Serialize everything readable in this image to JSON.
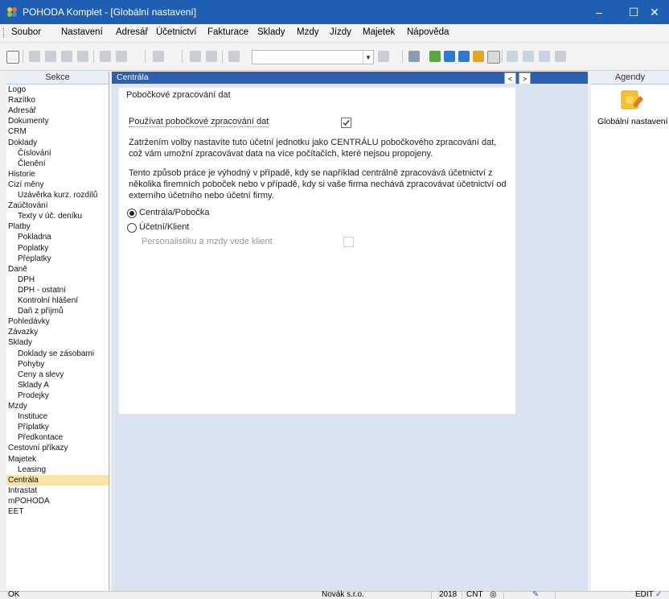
{
  "window": {
    "title": "POHODA Komplet - [Globální nastavení]",
    "minimize_glyph": "–",
    "maximize_glyph": "☐",
    "close_glyph": "✕"
  },
  "menu": [
    "Soubor",
    "Nastavení",
    "Adresář",
    "Účetnictví",
    "Fakturace",
    "Sklady",
    "Mzdy",
    "Jízdy",
    "Majetek",
    "Nápověda"
  ],
  "left_panel": {
    "header": "Sekce",
    "items": [
      {
        "label": "Logo",
        "level": 0
      },
      {
        "label": "Razítko",
        "level": 0
      },
      {
        "label": "Adresář",
        "level": 0
      },
      {
        "label": "Dokumenty",
        "level": 0
      },
      {
        "label": "CRM",
        "level": 0
      },
      {
        "label": "Doklady",
        "level": 0
      },
      {
        "label": "Číslování",
        "level": 1
      },
      {
        "label": "Členění",
        "level": 1
      },
      {
        "label": "Historie",
        "level": 0
      },
      {
        "label": "Cizí měny",
        "level": 0
      },
      {
        "label": "Uzávěrka kurz. rozdílů",
        "level": 1
      },
      {
        "label": "Zaúčtování",
        "level": 0
      },
      {
        "label": "Texty v úč. deníku",
        "level": 1
      },
      {
        "label": "Platby",
        "level": 0
      },
      {
        "label": "Pokladna",
        "level": 1
      },
      {
        "label": "Poplatky",
        "level": 1
      },
      {
        "label": "Přeplatky",
        "level": 1
      },
      {
        "label": "Daně",
        "level": 0
      },
      {
        "label": "DPH",
        "level": 1
      },
      {
        "label": "DPH - ostatní",
        "level": 1
      },
      {
        "label": "Kontrolní hlášení",
        "level": 1
      },
      {
        "label": "Daň z příjmů",
        "level": 1
      },
      {
        "label": "Pohledávky",
        "level": 0
      },
      {
        "label": "Závazky",
        "level": 0
      },
      {
        "label": "Sklady",
        "level": 0
      },
      {
        "label": "Doklady se zásobami",
        "level": 1
      },
      {
        "label": "Pohyby",
        "level": 1
      },
      {
        "label": "Ceny a slevy",
        "level": 1
      },
      {
        "label": "Sklady A",
        "level": 1
      },
      {
        "label": "Prodejky",
        "level": 1
      },
      {
        "label": "Mzdy",
        "level": 0
      },
      {
        "label": "Instituce",
        "level": 1
      },
      {
        "label": "Příplatky",
        "level": 1
      },
      {
        "label": "Předkontace",
        "level": 1
      },
      {
        "label": "Cestovní příkazy",
        "level": 0
      },
      {
        "label": "Majetek",
        "level": 0
      },
      {
        "label": "Leasing",
        "level": 1
      },
      {
        "label": "Centrála",
        "level": 0,
        "selected": true
      },
      {
        "label": "Intrastat",
        "level": 0
      },
      {
        "label": "mPOHODA",
        "level": 0
      },
      {
        "label": "EET",
        "level": 0
      }
    ]
  },
  "center": {
    "header": "Centrála",
    "prev_glyph": "<",
    "next_glyph": ">",
    "section_title": "Pobočkové zpracování dat",
    "use_branch_label": "Používat pobočkové zpracování dat",
    "use_branch_checked": true,
    "para1": "Zatržením volby nastavíte tuto účetní jednotku jako CENTRÁLU pobočkového zpracování dat, což vám umožní zpracovávat data na více počítačích, které nejsou propojeny.",
    "para2": "Tento způsob práce je výhodný v případě, kdy se například centrálně zpracovává účetnictví z několika firemních poboček nebo v případě, kdy si vaše firma nechává zpracovávat účetnictví od externího účetního nebo účetní firmy.",
    "radio1_label": "Centrála/Pobočka",
    "radio1_selected": true,
    "radio2_label": "Účetní/Klient",
    "radio2_selected": false,
    "payroll_label": "Personalistiku a mzdy vede klient",
    "payroll_checked": false
  },
  "right_panel": {
    "header": "Agendy",
    "agenda_label": "Globální nastavení"
  },
  "status": {
    "left": "OK",
    "company": "Novák s.r.o.",
    "year": "2018",
    "mode": "CNT",
    "circle_glyph": "◎",
    "edit": "EDIT"
  },
  "colors": {
    "titlebar": "#1e5fb4",
    "center_header": "#2f5fb0",
    "selected_item": "#fbe3a8",
    "body": "#d9e3f2"
  }
}
